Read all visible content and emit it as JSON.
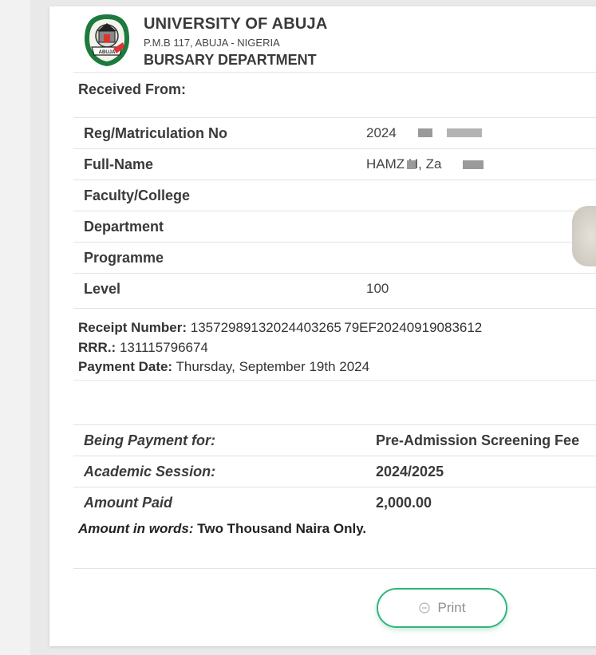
{
  "header": {
    "institution": "UNIVERSITY OF ABUJA",
    "address": "P.M.B 117, ABUJA - NIGERIA",
    "department": "BURSARY DEPARTMENT",
    "logo_text": "ABUJA"
  },
  "received_from_label": "Received From:",
  "student_details": [
    {
      "label": "Reg/Matriculation No",
      "value": "2024"
    },
    {
      "label": "Full-Name",
      "value": "HAMZ  H, Za"
    },
    {
      "label": "Faculty/College",
      "value": ""
    },
    {
      "label": "Department",
      "value": ""
    },
    {
      "label": "Programme",
      "value": ""
    },
    {
      "label": "Level",
      "value": "100"
    }
  ],
  "receipt": {
    "number_label": "Receipt Number:",
    "number": "13572989132024403265 79EF20240919083612",
    "rrr_label": "RRR.:",
    "rrr": "131115796674",
    "date_label": "Payment Date:",
    "date": "Thursday, September 19th 2024"
  },
  "payment_details": [
    {
      "label": "Being Payment for:",
      "value": "Pre-Admission Screening Fee"
    },
    {
      "label": "Academic Session:",
      "value": "2024/2025"
    },
    {
      "label": "Amount Paid",
      "value": "2,000.00"
    }
  ],
  "amount_words": {
    "label": "Amount in words:",
    "value": "Two Thousand Naira Only."
  },
  "print_button": {
    "label": "Print",
    "icon": "print-icon"
  },
  "colors": {
    "accent": "#2fb57c",
    "logo_green": "#1e7a3c"
  }
}
